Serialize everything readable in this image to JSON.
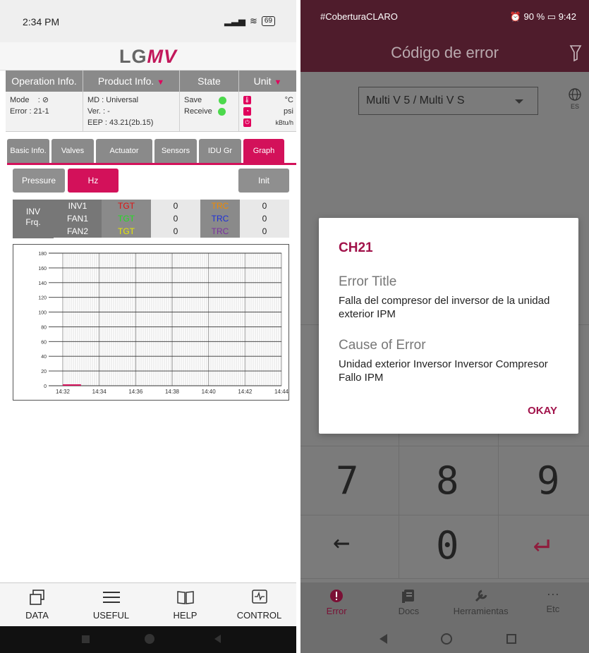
{
  "left": {
    "status": {
      "time": "2:34 PM",
      "battery": "69"
    },
    "logo": {
      "part1": "LG",
      "part2": "MV"
    },
    "info_headers": [
      "Operation Info.",
      "Product Info.",
      "State",
      "Unit"
    ],
    "op": {
      "mode_label": "Mode",
      "mode_value": ": ⊘",
      "error_label": "Error",
      "error_value": ": 21-1"
    },
    "product": {
      "md": "MD : Universal",
      "ver": "Ver. : -",
      "eep": "EEP : 43.21(2b.15)"
    },
    "state": {
      "save": "Save",
      "receive": "Receive"
    },
    "units": {
      "temp": "°C",
      "pressure": "psi",
      "power": "kBtu/h"
    },
    "tabs": [
      "Basic Info.",
      "Valves",
      "Actuator",
      "Sensors",
      "IDU Gr",
      "Graph"
    ],
    "active_tab": "Graph",
    "buttons": {
      "pressure": "Pressure",
      "hz": "Hz",
      "init": "Init"
    },
    "frq_label": [
      "INV",
      "Frq."
    ],
    "frq_rows": [
      {
        "name": "INV1",
        "tgt": "TGT",
        "tgt_color": "#e01010",
        "tgt_val": "0",
        "trc": "TRC",
        "trc_color": "#f08a00",
        "trc_val": "0"
      },
      {
        "name": "FAN1",
        "tgt": "TGT",
        "tgt_color": "#22dd22",
        "tgt_val": "0",
        "trc": "TRC",
        "trc_color": "#1c2fd8",
        "trc_val": "0"
      },
      {
        "name": "FAN2",
        "tgt": "TGT",
        "tgt_color": "#e8e800",
        "tgt_val": "0",
        "trc": "TRC",
        "trc_color": "#7a2fa0",
        "trc_val": "0"
      }
    ],
    "chart_data": {
      "type": "line",
      "title": "",
      "xlabel": "",
      "ylabel": "",
      "ylim": [
        0,
        180
      ],
      "y_ticks": [
        "0",
        "20",
        "40",
        "60",
        "80",
        "100",
        "120",
        "140",
        "160",
        "180"
      ],
      "x_ticks": [
        "14:32",
        "14:34",
        "14:36",
        "14:38",
        "14:40",
        "14:42",
        "14:44"
      ],
      "grid": true,
      "series": [
        {
          "x": [
            "14:32",
            "14:33"
          ],
          "values": [
            0,
            0
          ]
        }
      ]
    },
    "nav": [
      "DATA",
      "USEFUL",
      "HELP",
      "CONTROL"
    ]
  },
  "right": {
    "status": {
      "carrier": "#CoberturaCLARO",
      "battery": "90 %",
      "time": "9:42"
    },
    "title": "Código de error",
    "model": "Multi V 5 / Multi V S",
    "lang": "ES",
    "keys": [
      "7",
      "8",
      "9",
      "←",
      "0",
      "↵"
    ],
    "dialog": {
      "code": "CH21",
      "title_label": "Error Title",
      "title_text": "Falla del compresor del inversor de la unidad exterior IPM",
      "cause_label": "Cause of Error",
      "cause_text": "Unidad exterior Inversor Inversor Compresor Fallo IPM",
      "ok": "OKAY"
    },
    "nav": [
      "Error",
      "Docs",
      "Herramientas",
      "Etc"
    ],
    "accent": "#a1124a"
  }
}
